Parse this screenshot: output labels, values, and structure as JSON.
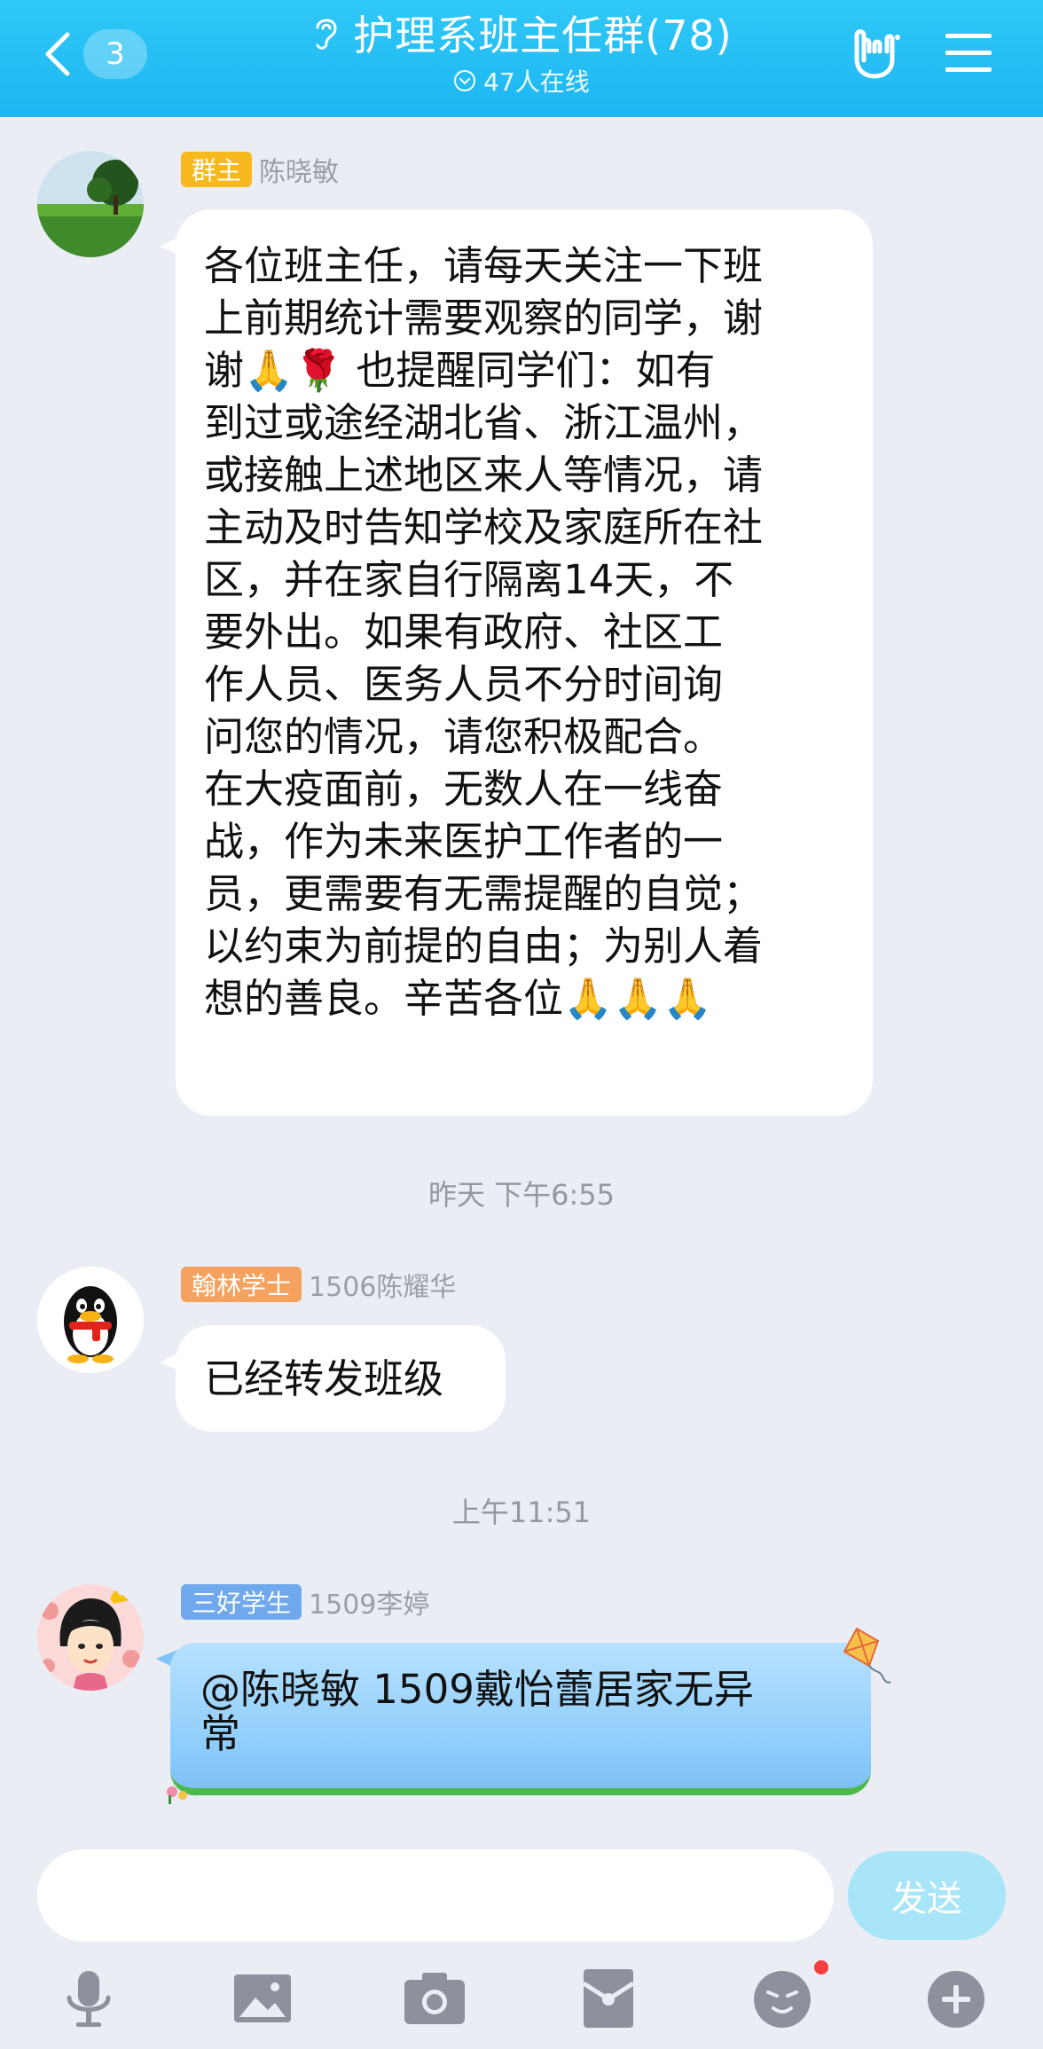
{
  "header": {
    "unread_count": "3",
    "title": "护理系班主任群(78)",
    "online": "47人在线"
  },
  "messages": [
    {
      "badge": "群主",
      "badge_color": "#f7b91e",
      "sender": "陈晓敏",
      "lines": [
        "各位班主任，请每天关注一下班",
        "上前期统计需要观察的同学，谢",
        "谢🙏🌹    也提醒同学们：如有",
        "到过或途经湖北省、浙江温州，",
        "或接触上述地区来人等情况，请",
        "主动及时告知学校及家庭所在社",
        "区，并在家自行隔离14天，不",
        "要外出。如果有政府、社区工",
        "作人员、医务人员不分时间询",
        "问您的情况，请您积极配合。",
        "在大疫面前，无数人在一线奋",
        "战，作为未来医护工作者的一",
        "员，更需要有无需提醒的自觉；",
        "以约束为前提的自由；为别人着",
        "想的善良。辛苦各位🙏🙏🙏"
      ]
    },
    {
      "badge": "翰林学士",
      "badge_color": "#f5a15f",
      "sender": "1506陈耀华",
      "text": "已经转发班级"
    },
    {
      "badge": "三好学生",
      "badge_color": "#6fa8ec",
      "sender": "1509李婷",
      "text_line1": "@陈晓敏 1509戴怡蕾居家无异",
      "text_line2": "常"
    }
  ],
  "timestamps": [
    "昨天 下午6:55",
    "上午11:51"
  ],
  "input": {
    "placeholder": "",
    "send_label": "发送"
  },
  "colors": {
    "header": "#1eb6f3",
    "background": "#ebedf5",
    "send_button": "#a8e5f8",
    "special_bubble": "#8fcdfb"
  },
  "toolbar": [
    "microphone-icon",
    "image-icon",
    "camera-icon",
    "red-packet-icon",
    "emoji-icon",
    "plus-icon"
  ]
}
